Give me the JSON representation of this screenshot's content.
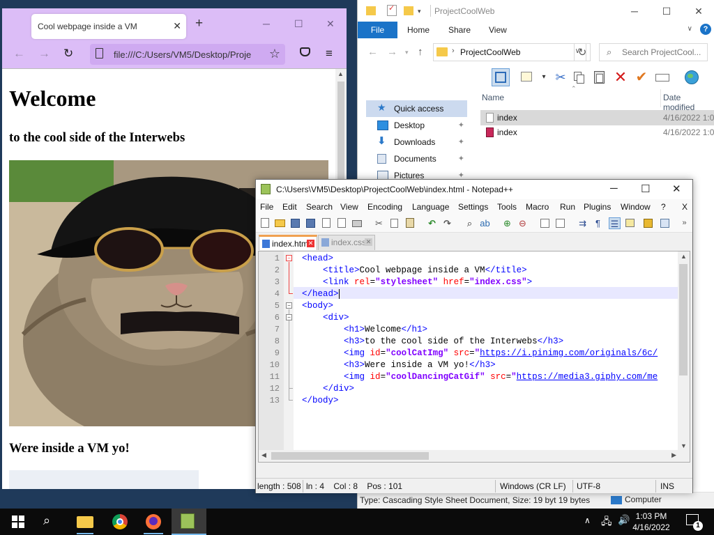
{
  "explorer": {
    "title": "ProjectCoolWeb",
    "ribbon_tabs": {
      "file": "File",
      "home": "Home",
      "share": "Share",
      "view": "View"
    },
    "address": "ProjectCoolWeb",
    "search_placeholder": "Search ProjectCool...",
    "columns": {
      "name": "Name",
      "date": "Date modified"
    },
    "nav": {
      "quick_access": "Quick access",
      "desktop": "Desktop",
      "downloads": "Downloads",
      "documents": "Documents",
      "pictures": "Pictures"
    },
    "files": [
      {
        "name": "index",
        "date": "4/16/2022 1:0",
        "icon": "css-file-icon"
      },
      {
        "name": "index",
        "date": "4/16/2022 1:0",
        "icon": "firefox-html-icon"
      }
    ],
    "status": "Type: Cascading Style Sheet Document, Size: 19 byt  19 bytes",
    "status_location": "Computer"
  },
  "firefox": {
    "tab_title": "Cool webpage inside a VM",
    "url": "file:///C:/Users/VM5/Desktop/Proje",
    "page": {
      "h1": "Welcome",
      "h3_first": "to the cool side of the Interwebs",
      "h3_second": "Were inside a VM yo!"
    }
  },
  "notepad": {
    "title": "C:\\Users\\VM5\\Desktop\\ProjectCoolWeb\\index.html - Notepad++",
    "menu": [
      "File",
      "Edit",
      "Search",
      "View",
      "Encoding",
      "Language",
      "Settings",
      "Tools",
      "Macro",
      "Run",
      "Plugins",
      "Window",
      "?"
    ],
    "menu_close": "X",
    "tabs": [
      "index.html",
      "index.css"
    ],
    "line_numbers": [
      "1",
      "2",
      "3",
      "4",
      "5",
      "6",
      "7",
      "8",
      "9",
      "10",
      "11",
      "12",
      "13"
    ],
    "code": {
      "l1_tag": "<head>",
      "l2_open": "<title>",
      "l2_text": "Cool webpage inside a VM",
      "l2_close": "</title>",
      "l3_tag": "<link",
      "l3_attr1": "rel",
      "l3_val1": "\"stylesheet\"",
      "l3_attr2": "href",
      "l3_val2": "\"index.css\"",
      "l3_end": ">",
      "l4_tag": "</head>",
      "l5_tag": "<body>",
      "l6_tag": "<div>",
      "l7_open": "<h1>",
      "l7_text": "Welcome",
      "l7_close": "</h1>",
      "l8_open": "<h3>",
      "l8_text": "to the cool side of the Interwebs",
      "l8_close": "</h3>",
      "l9_tag": "<img",
      "l9_attr1": "id",
      "l9_val1": "\"coolCatImg\"",
      "l9_attr2": "src",
      "l9_q": "\"",
      "l9_url": "https://i.pinimg.com/originals/6c/",
      "l10_open": "<h3>",
      "l10_text": "Were inside a VM yo!",
      "l10_close": "</h3>",
      "l11_tag": "<img",
      "l11_attr1": "id",
      "l11_val1": "\"coolDancingCatGif\"",
      "l11_attr2": "src",
      "l11_q": "\"",
      "l11_url": "https://media3.giphy.com/me",
      "l12_tag": "</div>",
      "l13_tag": "</body>"
    },
    "status": {
      "length": "length : 508",
      "pos": "ln : 4    Col : 8    Pos : 101",
      "eol": "Windows (CR LF)",
      "encoding": "UTF-8",
      "mode": "INS"
    }
  },
  "taskbar": {
    "time": "1:03 PM",
    "date": "4/16/2022",
    "notifications": "1"
  }
}
